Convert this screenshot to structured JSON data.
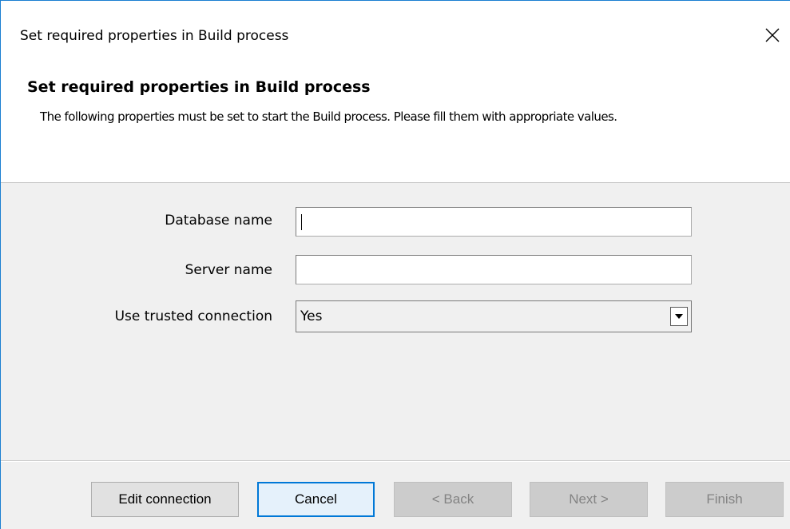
{
  "window": {
    "title": "Set required properties in Build process"
  },
  "header": {
    "title": "Set required properties in Build process",
    "description": "The following properties must be set to start the Build process. Please fill them with appropriate values."
  },
  "form": {
    "database_name": {
      "label": "Database name",
      "value": ""
    },
    "server_name": {
      "label": "Server name",
      "value": ""
    },
    "trusted_connection": {
      "label": "Use trusted connection",
      "value": "Yes"
    }
  },
  "buttons": {
    "edit_connection": "Edit connection",
    "cancel": "Cancel",
    "back": "< Back",
    "next": "Next >",
    "finish": "Finish"
  },
  "icons": {
    "close": "close-icon",
    "dropdown": "chevron-down-icon"
  },
  "colors": {
    "accent": "#0078d7",
    "window_border": "#1a7fd1",
    "panel_background": "#f0f0f0"
  }
}
